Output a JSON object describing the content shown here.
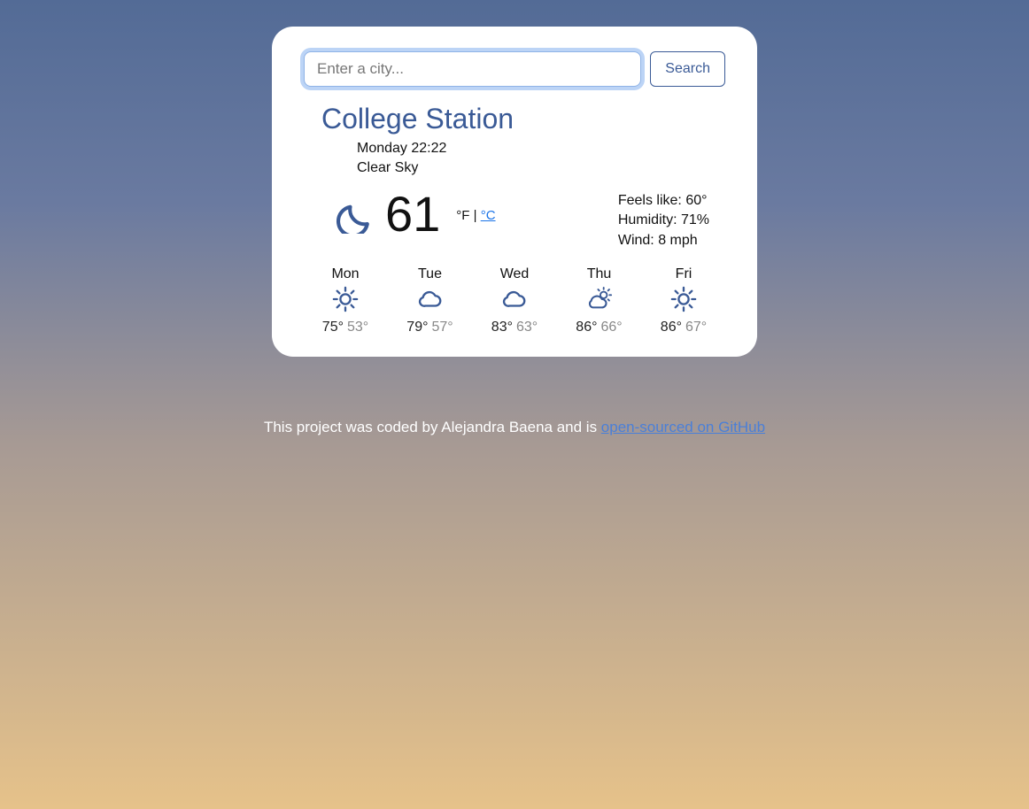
{
  "search": {
    "placeholder": "Enter a city...",
    "button": "Search"
  },
  "city": "College Station",
  "datetime": "Monday 22:22",
  "condition": "Clear Sky",
  "temperature": "61",
  "unit_f": "°F",
  "unit_sep": " | ",
  "unit_c": "°C",
  "feels_like_label": "Feels like: ",
  "feels_like_value": "60°",
  "humidity_label": "Humidity: ",
  "humidity_value": "71%",
  "wind_label": "Wind: ",
  "wind_value": "8 mph",
  "forecast": [
    {
      "day": "Mon",
      "icon": "sun",
      "hi": "75°",
      "lo": "53°"
    },
    {
      "day": "Tue",
      "icon": "cloud",
      "hi": "79°",
      "lo": "57°"
    },
    {
      "day": "Wed",
      "icon": "cloud",
      "hi": "83°",
      "lo": "63°"
    },
    {
      "day": "Thu",
      "icon": "partly-sun",
      "hi": "86°",
      "lo": "66°"
    },
    {
      "day": "Fri",
      "icon": "sun",
      "hi": "86°",
      "lo": "67°"
    }
  ],
  "footer_prefix": "This project was coded by Alejandra Baena and is ",
  "footer_link": "open-sourced on GitHub"
}
